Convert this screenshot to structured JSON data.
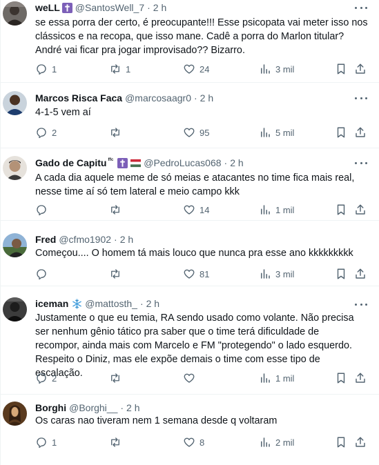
{
  "colors": {
    "text": "#0f1419",
    "muted": "#536471",
    "divider": "#eff3f4"
  },
  "tweets": [
    {
      "name": "weLL",
      "badges": [
        "cross-badge-icon"
      ],
      "handle": "@SantosWell_7",
      "time": "2 h",
      "lines": [
        "se essa porra der certo, é preocupante!!! Esse psicopata vai meter isso nos",
        "clássicos e na recopa, que isso mane. Cadê a porra do Marlon titular?",
        "André vai ficar pra jogar improvisado?? Bizarro."
      ],
      "replies": "1",
      "retweets": "1",
      "likes": "24",
      "views": "3 mil"
    },
    {
      "name": "Marcos Risca Faca",
      "badges": [],
      "handle": "@marcosaagr0",
      "time": "2 h",
      "lines": [
        "4-1-5 vem aí"
      ],
      "replies": "2",
      "retweets": "",
      "likes": "95",
      "views": "5 mil"
    },
    {
      "name": "Gado de Capitu",
      "name_suffix": "ᶠᶠᶜ",
      "badges": [
        "cross-badge-icon",
        "hungary-flag-icon"
      ],
      "handle": "@PedroLucas068",
      "time": "2 h",
      "lines": [
        "A cada dia aquele meme de só meias e atacantes no time fica mais real,",
        "nesse time aí só tem lateral e meio campo kkk"
      ],
      "replies": "",
      "retweets": "",
      "likes": "14",
      "views": "1 mil"
    },
    {
      "name": "Fred",
      "badges": [],
      "handle": "@cfmo1902",
      "time": "2 h",
      "lines": [
        "Começou.... O homem tá mais louco que nunca pra esse ano kkkkkkkkk"
      ],
      "replies": "",
      "retweets": "",
      "likes": "81",
      "views": "3 mil"
    },
    {
      "name": "iceman",
      "badges": [
        "snowflake-icon"
      ],
      "handle": "@mattosth_",
      "time": "2 h",
      "lines": [
        "Justamente o que eu temia, RA sendo usado como volante. Não precisa",
        "ser nenhum gênio tático pra saber que o time terá dificuldade de",
        "recompor, ainda mais com Marcelo e FM \"protegendo\" o lado esquerdo.",
        "Respeito o Diniz, mas ele expõe demais o time com esse tipo de escalação."
      ],
      "replies": "2",
      "retweets": "",
      "likes": "",
      "views": "1 mil"
    },
    {
      "name": "Borghi",
      "badges": [],
      "handle": "@Borghi__",
      "time": "2 h",
      "lines": [
        "Os caras nao tiveram nem 1 semana desde q voltaram"
      ],
      "replies": "1",
      "retweets": "",
      "likes": "8",
      "views": "2 mil"
    }
  ]
}
